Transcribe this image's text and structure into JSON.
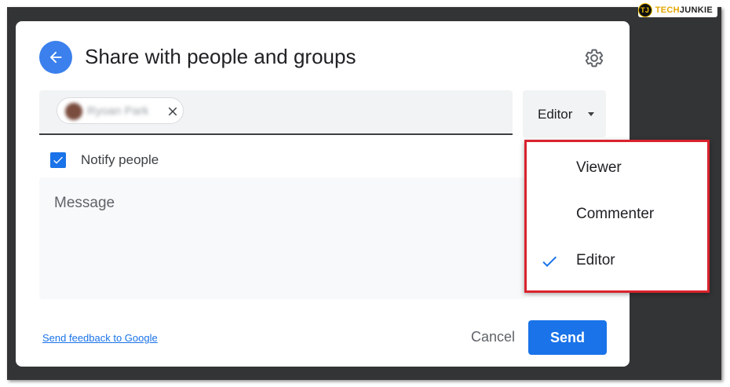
{
  "header": {
    "title": "Share with people and groups"
  },
  "recipients": {
    "chip_name": "Ryoan Park"
  },
  "role_select": {
    "selected": "Editor"
  },
  "notify": {
    "label": "Notify people",
    "checked": true
  },
  "message": {
    "placeholder": "Message"
  },
  "footer": {
    "feedback_link": "Send feedback to Google",
    "cancel_label": "Cancel",
    "send_label": "Send"
  },
  "role_menu": {
    "items": [
      {
        "label": "Viewer",
        "selected": false
      },
      {
        "label": "Commenter",
        "selected": false
      },
      {
        "label": "Editor",
        "selected": true
      }
    ]
  },
  "watermark": {
    "logo": "TJ",
    "brand_part1": "TECH",
    "brand_part2": "JUNKIE"
  },
  "colors": {
    "accent": "#1a73e8",
    "back_button": "#3b80ec",
    "highlight_border": "#d9232d",
    "backdrop": "#333436"
  },
  "icons": [
    "back-arrow-icon",
    "gear-icon",
    "close-icon",
    "dropdown-caret-icon",
    "checkbox-check-icon",
    "checkmark-icon"
  ]
}
